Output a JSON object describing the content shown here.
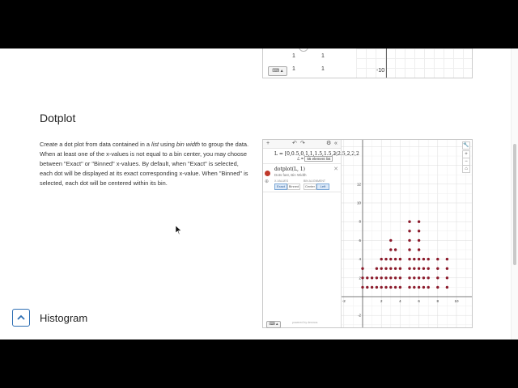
{
  "top_widget": {
    "rows": [
      {
        "a": "1",
        "b": "1"
      },
      {
        "a": "1",
        "b": "1"
      }
    ],
    "axis_label": "-10"
  },
  "section": {
    "title": "Dotplot",
    "description": {
      "part1": "Create a dot plot from data contained in a ",
      "list_word": "list",
      "part2": " using ",
      "bin_word": "bin width",
      "part3": " to group the data. When at least one of the x-values is not equal to a bin center, you may choose between \"Exact\" or \"Binned\" x-values. By default, when \"Exact\" is selected, each dot will be displayed at its exact corresponding x-value. When \"Binned\" is selected, each dot will be centered within its bin."
    }
  },
  "calculator": {
    "toolbar": {
      "add": "+",
      "undo": "↶",
      "redo": "↷",
      "settings": "⚙",
      "collapse": "«"
    },
    "expression1": "L = [0,0.5,0,1,1,1.5,1.5,2,2.5,2,2,2",
    "expression1_badge": "55 element list",
    "expression2": "dotplot(L, 1)",
    "expression2_sub": "Dots fast, Bin Width",
    "xaxis_label": "X-VALUES",
    "align_label": "BIN ALIGNMENT",
    "buttons": [
      {
        "label": "Exact",
        "selected": true
      },
      {
        "label": "Binned",
        "selected": false
      },
      {
        "label": "Center",
        "selected": false
      },
      {
        "label": "Left",
        "selected": true
      }
    ],
    "powered": "powered by desmos",
    "graph_controls": [
      "🔧",
      "+",
      "−",
      "⌂"
    ],
    "x_ticks": [
      "-2",
      "2",
      "4",
      "6",
      "8",
      "10"
    ],
    "y_ticks": [
      "12",
      "10",
      "8",
      "6",
      "4",
      "2",
      "-2"
    ],
    "dots": [
      [
        0,
        1
      ],
      [
        0,
        2
      ],
      [
        0,
        3
      ],
      [
        0.5,
        1
      ],
      [
        0.5,
        2
      ],
      [
        1,
        1
      ],
      [
        1,
        2
      ],
      [
        1.5,
        1
      ],
      [
        1.5,
        2
      ],
      [
        1.5,
        3
      ],
      [
        2,
        1
      ],
      [
        2,
        2
      ],
      [
        2,
        3
      ],
      [
        2,
        4
      ],
      [
        2.5,
        1
      ],
      [
        2.5,
        2
      ],
      [
        2.5,
        3
      ],
      [
        2.5,
        4
      ],
      [
        3,
        1
      ],
      [
        3,
        2
      ],
      [
        3,
        3
      ],
      [
        3,
        4
      ],
      [
        3,
        5
      ],
      [
        3,
        6
      ],
      [
        3.5,
        1
      ],
      [
        3.5,
        2
      ],
      [
        3.5,
        3
      ],
      [
        3.5,
        4
      ],
      [
        3.5,
        5
      ],
      [
        4,
        1
      ],
      [
        4,
        2
      ],
      [
        4,
        3
      ],
      [
        4,
        4
      ],
      [
        5,
        1
      ],
      [
        5,
        2
      ],
      [
        5,
        3
      ],
      [
        5,
        4
      ],
      [
        5,
        5
      ],
      [
        5,
        6
      ],
      [
        5,
        7
      ],
      [
        5,
        8
      ],
      [
        5.5,
        1
      ],
      [
        5.5,
        2
      ],
      [
        5.5,
        3
      ],
      [
        5.5,
        4
      ],
      [
        6,
        1
      ],
      [
        6,
        2
      ],
      [
        6,
        3
      ],
      [
        6,
        4
      ],
      [
        6,
        5
      ],
      [
        6,
        6
      ],
      [
        6,
        7
      ],
      [
        6,
        8
      ],
      [
        6.5,
        1
      ],
      [
        6.5,
        2
      ],
      [
        6.5,
        3
      ],
      [
        6.5,
        4
      ],
      [
        7,
        1
      ],
      [
        7,
        2
      ],
      [
        7,
        3
      ],
      [
        7,
        4
      ],
      [
        8,
        1
      ],
      [
        8,
        2
      ],
      [
        8,
        3
      ],
      [
        8,
        4
      ],
      [
        9,
        1
      ],
      [
        9,
        2
      ],
      [
        9,
        3
      ],
      [
        9,
        4
      ]
    ],
    "dot_color": "#8b1a2b"
  },
  "next_section": {
    "title": "Histogram"
  },
  "colors": {
    "accent": "#2e6fb4"
  }
}
